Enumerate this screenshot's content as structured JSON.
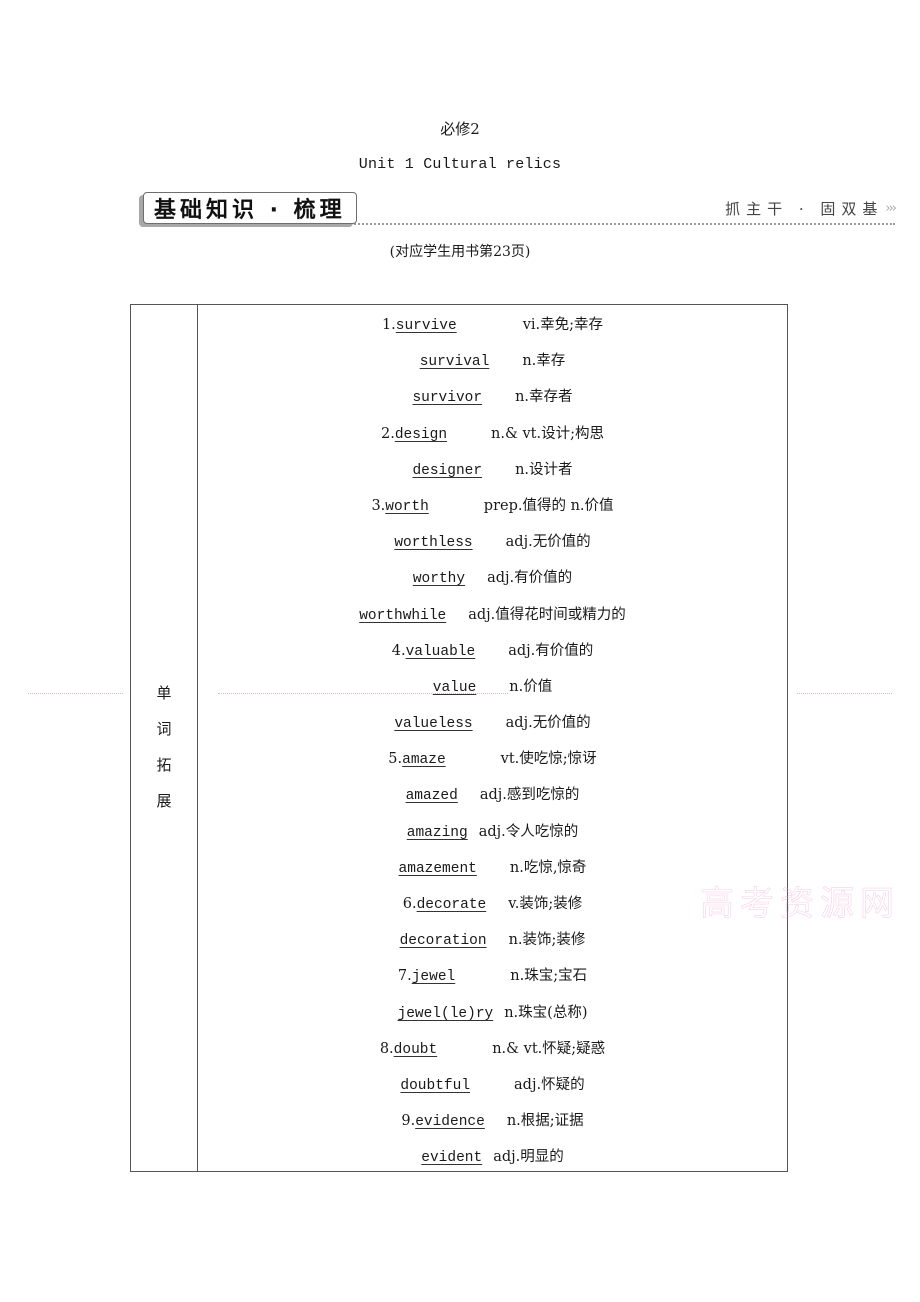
{
  "header": {
    "subject": "必修2",
    "unit_title": "Unit 1  Cultural relics"
  },
  "section": {
    "title": "基础知识 · 梳理",
    "tagline": "抓主干 · 固双基",
    "tagline_icon": "triple-chevron-right-icon",
    "tagline_glyph": "›››"
  },
  "page_reference": "(对应学生用书第23页)",
  "table": {
    "category": [
      "单",
      "词",
      "拓",
      "展"
    ],
    "entries": [
      {
        "num": "1.",
        "word": "survive",
        "gap": 6,
        "pos": "vi.",
        "meaning": "幸免;幸存"
      },
      {
        "num": "",
        "word": "survival",
        "gap": 3,
        "pos": "n.",
        "meaning": "幸存"
      },
      {
        "num": "",
        "word": "survivor",
        "gap": 3,
        "pos": "n.",
        "meaning": "幸存者"
      },
      {
        "num": "2.",
        "word": "design",
        "gap": 4,
        "pos": "n.& vt.",
        "meaning": "设计;构思"
      },
      {
        "num": "",
        "word": "designer",
        "gap": 3,
        "pos": "n.",
        "meaning": "设计者"
      },
      {
        "num": "3.",
        "word": "worth",
        "gap": 5,
        "pos": "prep.",
        "meaning": "值得的 n.价值"
      },
      {
        "num": "",
        "word": "worthless",
        "gap": 3,
        "pos": "adj.",
        "meaning": "无价值的"
      },
      {
        "num": "",
        "word": "worthy",
        "gap": 2,
        "pos": "adj.",
        "meaning": "有价值的"
      },
      {
        "num": "",
        "word": "worthwhile",
        "gap": 2,
        "pos": "adj.",
        "meaning": "值得花时间或精力的"
      },
      {
        "num": "4.",
        "word": "valuable",
        "gap": 3,
        "pos": "adj.",
        "meaning": "有价值的"
      },
      {
        "num": "",
        "word": "value",
        "gap": 3,
        "pos": "n.",
        "meaning": "价值"
      },
      {
        "num": "",
        "word": "valueless",
        "gap": 3,
        "pos": "adj.",
        "meaning": "无价值的"
      },
      {
        "num": "5.",
        "word": "amaze",
        "gap": 5,
        "pos": "vt.",
        "meaning": "使吃惊;惊讶"
      },
      {
        "num": "",
        "word": "amazed",
        "gap": 2,
        "pos": "adj.",
        "meaning": "感到吃惊的"
      },
      {
        "num": "",
        "word": "amazing",
        "gap": 1,
        "pos": "adj.",
        "meaning": "令人吃惊的"
      },
      {
        "num": "",
        "word": "amazement",
        "gap": 3,
        "pos": "n.",
        "meaning": "吃惊,惊奇"
      },
      {
        "num": "6.",
        "word": "decorate",
        "gap": 2,
        "pos": "v.",
        "meaning": "装饰;装修"
      },
      {
        "num": "",
        "word": "decoration",
        "gap": 2,
        "pos": "n.",
        "meaning": "装饰;装修"
      },
      {
        "num": "7.",
        "word": "jewel",
        "gap": 5,
        "pos": "n.",
        "meaning": "珠宝;宝石"
      },
      {
        "num": "",
        "word": "jewel(le)ry",
        "gap": 1,
        "pos": "n.",
        "meaning": "珠宝(总称)"
      },
      {
        "num": "8.",
        "word": "doubt",
        "gap": 5,
        "pos": "n.& vt.",
        "meaning": "怀疑;疑惑"
      },
      {
        "num": "",
        "word": "doubtful",
        "gap": 4,
        "pos": "adj.",
        "meaning": "怀疑的"
      },
      {
        "num": "9.",
        "word": "evidence",
        "gap": 2,
        "pos": "n.",
        "meaning": "根据;证据"
      },
      {
        "num": "",
        "word": "evident",
        "gap": 1,
        "pos": "adj.",
        "meaning": "明显的"
      }
    ]
  },
  "watermark": "高考资源网"
}
